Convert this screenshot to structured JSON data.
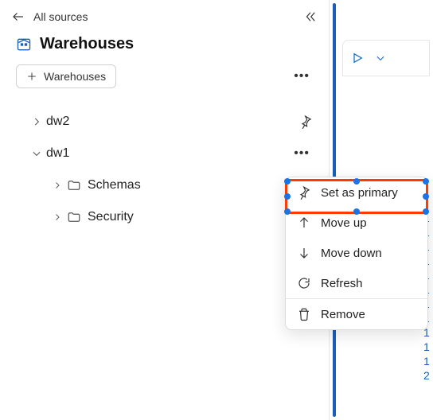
{
  "header": {
    "back_label": "All sources",
    "title": "Warehouses"
  },
  "toolbar": {
    "add_label": "Warehouses"
  },
  "tree": {
    "items": [
      {
        "label": "dw2"
      },
      {
        "label": "dw1"
      }
    ],
    "children": [
      {
        "label": "Schemas"
      },
      {
        "label": "Security"
      }
    ]
  },
  "context_menu": {
    "set_primary": "Set as primary",
    "move_up": "Move up",
    "move_down": "Move down",
    "refresh": "Refresh",
    "remove": "Remove"
  },
  "line_numbers": [
    "1",
    "1",
    "1",
    "1",
    "1",
    "1",
    "1",
    "1",
    "1",
    "1",
    "1",
    "2"
  ]
}
